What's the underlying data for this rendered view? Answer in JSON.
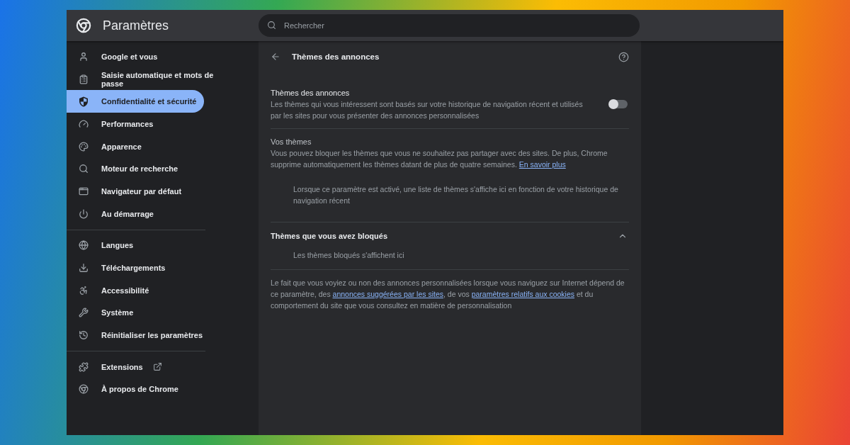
{
  "header": {
    "title": "Paramètres",
    "search_placeholder": "Rechercher"
  },
  "sidebar": {
    "groups": [
      [
        {
          "label": "Google et vous",
          "selected": false
        },
        {
          "label": "Saisie automatique et mots de passe",
          "selected": false
        },
        {
          "label": "Confidentialité et sécurité",
          "selected": true
        },
        {
          "label": "Performances",
          "selected": false
        },
        {
          "label": "Apparence",
          "selected": false
        },
        {
          "label": "Moteur de recherche",
          "selected": false
        },
        {
          "label": "Navigateur par défaut",
          "selected": false
        },
        {
          "label": "Au démarrage",
          "selected": false
        }
      ],
      [
        {
          "label": "Langues",
          "selected": false
        },
        {
          "label": "Téléchargements",
          "selected": false
        },
        {
          "label": "Accessibilité",
          "selected": false
        },
        {
          "label": "Système",
          "selected": false
        },
        {
          "label": "Réinitialiser les paramètres",
          "selected": false
        }
      ],
      [
        {
          "label": "Extensions",
          "selected": false,
          "kind": "external"
        },
        {
          "label": "À propos de Chrome",
          "selected": false,
          "kind": "plain"
        }
      ]
    ]
  },
  "page": {
    "title": "Thèmes des annonces",
    "setting": {
      "title": "Thèmes des annonces",
      "description": "Les thèmes qui vous intéressent sont basés sur votre historique de navigation récent et utilisés par les sites pour vous présenter des annonces personnalisées",
      "on": false
    },
    "your_topics": {
      "title": "Vos thèmes",
      "description": [
        {
          "kind": "text",
          "text": "Vous pouvez bloquer les thèmes que vous ne souhaitez pas partager avec des sites. De plus, Chrome supprime automatiquement les thèmes datant de plus de quatre semaines. "
        },
        {
          "kind": "link",
          "text": "En savoir plus"
        }
      ],
      "empty_text": "Lorsque ce paramètre est activé, une liste de thèmes s'affiche ici en fonction de votre historique de navigation récent"
    },
    "blocked": {
      "title": "Thèmes que vous avez bloqués",
      "expanded": true,
      "empty_text": "Les thèmes bloqués s'affichent ici"
    },
    "footer": [
      {
        "kind": "text",
        "text": "Le fait que vous voyiez ou non des annonces personnalisées lorsque vous naviguez sur Internet dépend de ce paramètre, des "
      },
      {
        "kind": "link",
        "text": "annonces suggérées par les sites"
      },
      {
        "kind": "text",
        "text": ", de vos "
      },
      {
        "kind": "link",
        "text": "paramètres relatifs aux cookies"
      },
      {
        "kind": "text",
        "text": " et du comportement du site que vous consultez en matière de personnalisation"
      }
    ]
  }
}
